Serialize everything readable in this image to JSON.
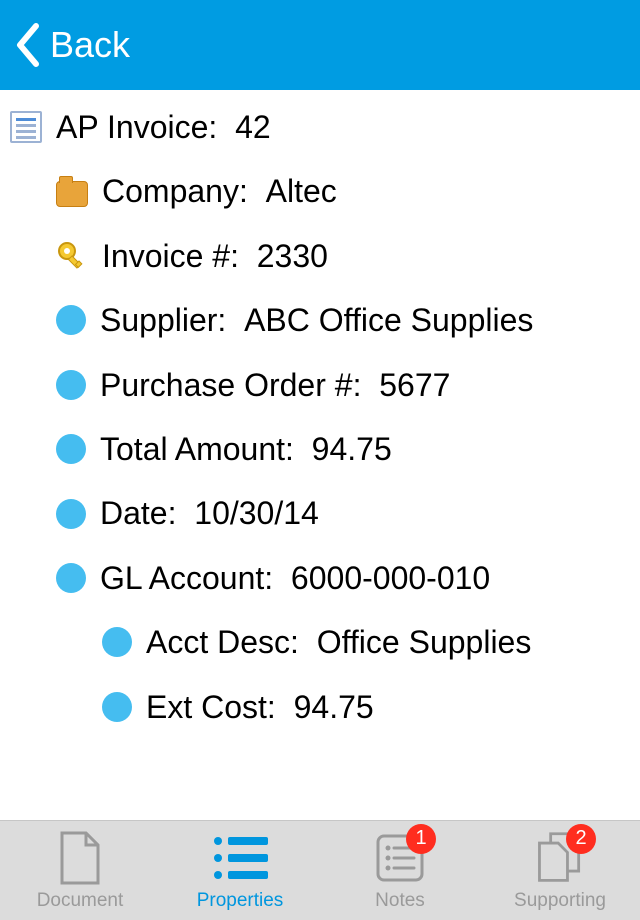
{
  "navbar": {
    "back_label": "Back"
  },
  "properties": {
    "header_label": "AP Invoice:",
    "header_value": "42",
    "rows": [
      {
        "label": "Company:",
        "value": "Altec"
      },
      {
        "label": "Invoice #:",
        "value": "2330"
      },
      {
        "label": "Supplier:",
        "value": "ABC Office Supplies"
      },
      {
        "label": "Purchase Order #:",
        "value": "5677"
      },
      {
        "label": "Total Amount:",
        "value": "94.75"
      },
      {
        "label": "Date:",
        "value": "10/30/14"
      },
      {
        "label": "GL Account:",
        "value": "6000-000-010"
      },
      {
        "label": "Acct Desc:",
        "value": "Office Supplies"
      },
      {
        "label": "Ext Cost:",
        "value": "94.75"
      }
    ]
  },
  "tabs": {
    "document": "Document",
    "properties": "Properties",
    "notes": "Notes",
    "notes_badge": "1",
    "supporting": "Supporting",
    "supporting_badge": "2"
  }
}
